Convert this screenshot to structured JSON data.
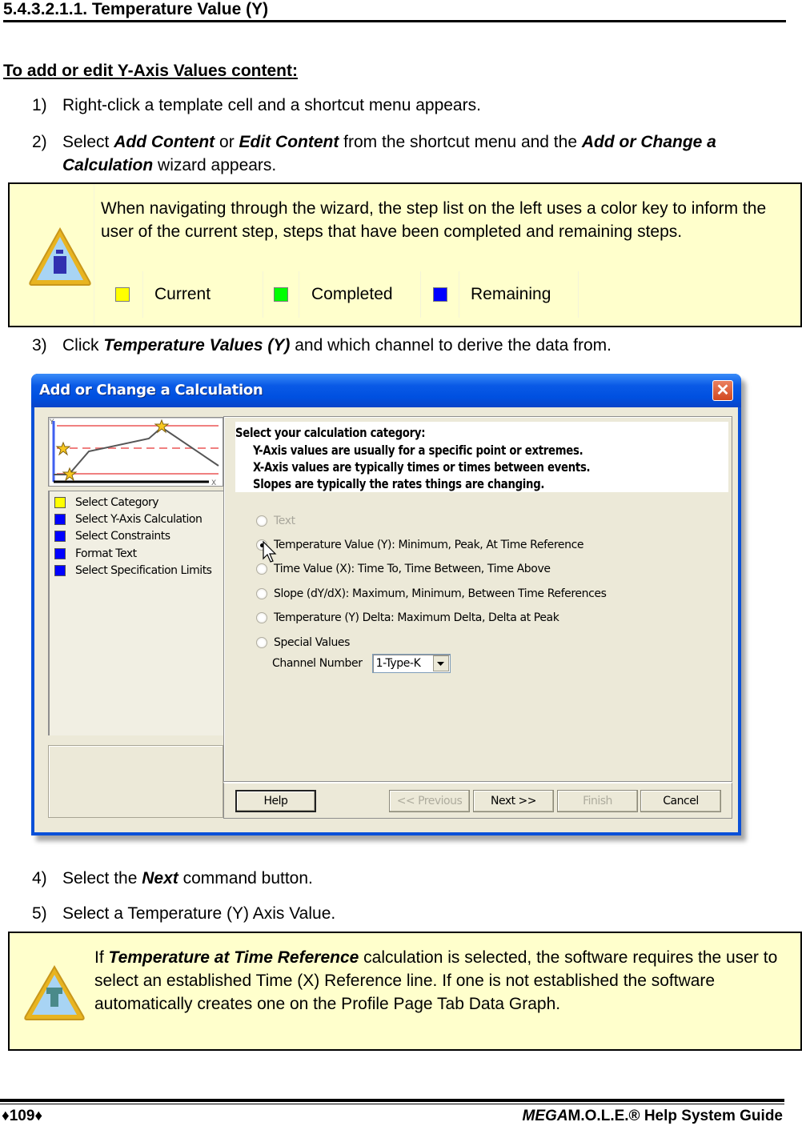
{
  "heading": "5.4.3.2.1.1. Temperature Value (Y)",
  "subheading": "To add or edit Y-Axis Values content:",
  "steps": [
    {
      "num": "1)",
      "parts": [
        {
          "t": "Right-click a template cell and a shortcut menu appears."
        }
      ]
    },
    {
      "num": "2)",
      "parts": [
        {
          "t": "Select "
        },
        {
          "t": "Add Content",
          "em": true
        },
        {
          "t": " or "
        },
        {
          "t": "Edit Content",
          "em": true
        },
        {
          "t": " from the shortcut menu and the "
        },
        {
          "t": "Add or Change a Calculation",
          "em": true
        },
        {
          "t": " wizard appears."
        }
      ]
    },
    {
      "num": "3)",
      "parts": [
        {
          "t": "Click "
        },
        {
          "t": "Temperature Values (Y)",
          "em": true
        },
        {
          "t": " and which channel to derive the data from."
        }
      ]
    },
    {
      "num": "4)",
      "parts": [
        {
          "t": "Select the "
        },
        {
          "t": "Next",
          "em": true
        },
        {
          "t": " command button."
        }
      ]
    },
    {
      "num": "5)",
      "parts": [
        {
          "t": "Select a Temperature (Y) Axis Value."
        }
      ]
    }
  ],
  "note1": {
    "icon": "info-warning-icon",
    "text": "When navigating through the wizard, the step list on the left uses a color key to inform the user of the current step, steps that have been completed and remaining steps.",
    "legend": [
      {
        "label": "Current",
        "color": "#ffff00"
      },
      {
        "label": "Completed",
        "color": "#00ff00"
      },
      {
        "label": "Remaining",
        "color": "#0000ff"
      }
    ]
  },
  "dialog": {
    "title": "Add or Change a Calculation",
    "close_label": "✕",
    "steps": [
      {
        "label": "Select Category",
        "status": "current",
        "color": "#ffff00"
      },
      {
        "label": "Select Y-Axis Calculation",
        "status": "remaining",
        "color": "#0000ff"
      },
      {
        "label": "Select Constraints",
        "status": "remaining",
        "color": "#0000ff"
      },
      {
        "label": "Format Text",
        "status": "remaining",
        "color": "#0000ff"
      },
      {
        "label": "Select Specification Limits",
        "status": "remaining",
        "color": "#0000ff"
      }
    ],
    "graph": {
      "y_label": "Y",
      "x_label": "X"
    },
    "info_lines": [
      "Select your calculation category:",
      "Y-Axis values are usually for a specific point or extremes.",
      "X-Axis values are typically times or times between events.",
      "Slopes are typically the rates things are changing."
    ],
    "options": [
      {
        "label": "Text",
        "checked": false,
        "disabled": true
      },
      {
        "label": "Temperature Value (Y):  Minimum, Peak, At Time Reference",
        "checked": true,
        "disabled": false
      },
      {
        "label": "Time Value (X):  Time To, Time Between, Time Above",
        "checked": false,
        "disabled": false
      },
      {
        "label": "Slope (dY/dX):  Maximum, Minimum, Between Time References",
        "checked": false,
        "disabled": false
      },
      {
        "label": "Temperature (Y) Delta:  Maximum Delta, Delta at Peak",
        "checked": false,
        "disabled": false
      },
      {
        "label": "Special  Values",
        "checked": false,
        "disabled": false
      }
    ],
    "channel": {
      "label": "Channel Number",
      "value": "1-Type-K"
    },
    "buttons": {
      "help": "Help",
      "previous": "<< Previous",
      "next": "Next >>",
      "finish": "Finish",
      "cancel": "Cancel"
    }
  },
  "note2": {
    "icon": "tip-warning-icon",
    "parts": [
      {
        "t": "If "
      },
      {
        "t": "Temperature at Time Reference",
        "em": true
      },
      {
        "t": " calculation is selected, the software requires the user to select an established Time (X) Reference line. If one is not established the software automatically creates one on the Profile Page Tab Data Graph."
      }
    ]
  },
  "footer": {
    "page": "♦109♦",
    "brand_italic": "MEGA",
    "brand_rest": "M.O.L.E.® Help System Guide"
  }
}
